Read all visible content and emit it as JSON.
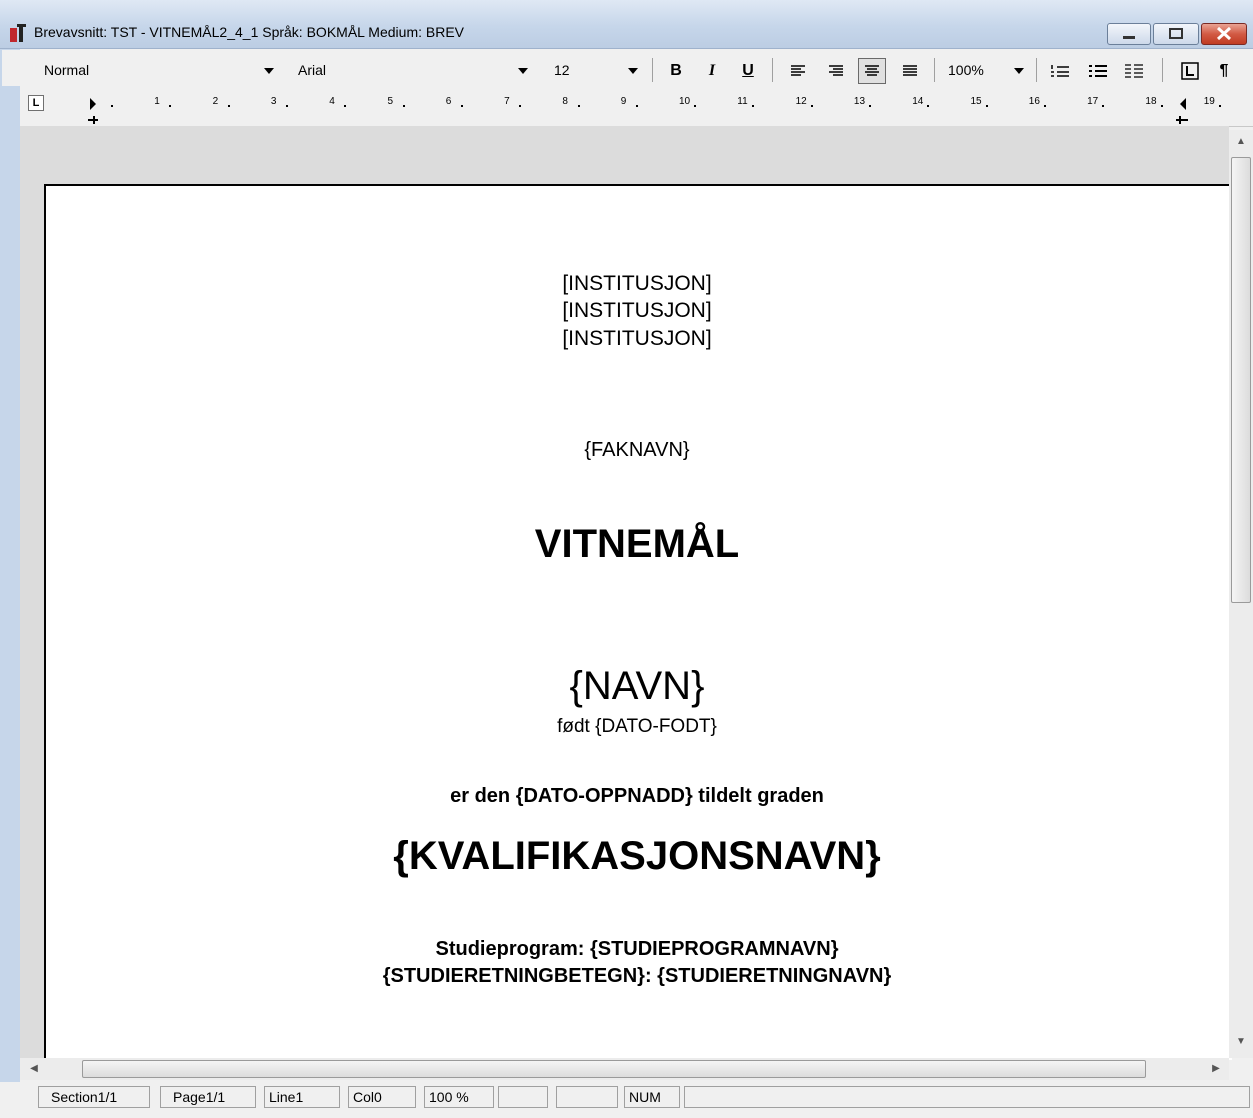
{
  "window": {
    "title": "Brevavsnitt: TST - VITNEMÅL2_4_1 Språk: BOKMÅL Medium: BREV"
  },
  "toolbar": {
    "style_value": "Normal",
    "font_value": "Arial",
    "size_value": "12",
    "bold_label": "B",
    "italic_label": "I",
    "underline_label": "U",
    "zoom_value": "100%",
    "pilcrow_label": "¶"
  },
  "ruler": {
    "numbers": [
      "1",
      "2",
      "3",
      "4",
      "5",
      "6",
      "7",
      "8",
      "9",
      "10",
      "11",
      "12",
      "13",
      "14",
      "15",
      "16",
      "17",
      "18",
      "19"
    ]
  },
  "document": {
    "institution_lines": [
      "[INSTITUSJON]",
      "[INSTITUSJON]",
      "[INSTITUSJON]"
    ],
    "faculty": "{FAKNAVN}",
    "heading": "VITNEMÅL",
    "name": "{NAVN}",
    "born": "født {DATO-FODT}",
    "awarded": "er den {DATO-OPPNADD} tildelt graden",
    "qualification": "{KVALIFIKASJONSNAVN}",
    "study_program": "Studieprogram: {STUDIEPROGRAMNAVN}",
    "study_direction": "{STUDIERETNINGBETEGN}: {STUDIERETNINGNAVN}"
  },
  "statusbar": {
    "section": "Section1/1",
    "page": "Page1/1",
    "line": "Line1",
    "col": "Col0",
    "zoom": "100 %",
    "num": "NUM"
  },
  "icons": [
    "app-icon",
    "minimize-icon",
    "maximize-icon",
    "close-icon",
    "align-left-icon",
    "align-right-icon",
    "align-center-icon",
    "justify-icon",
    "numbered-list-icon",
    "bullet-list-icon",
    "outline-list-icon",
    "tab-stop-icon"
  ]
}
